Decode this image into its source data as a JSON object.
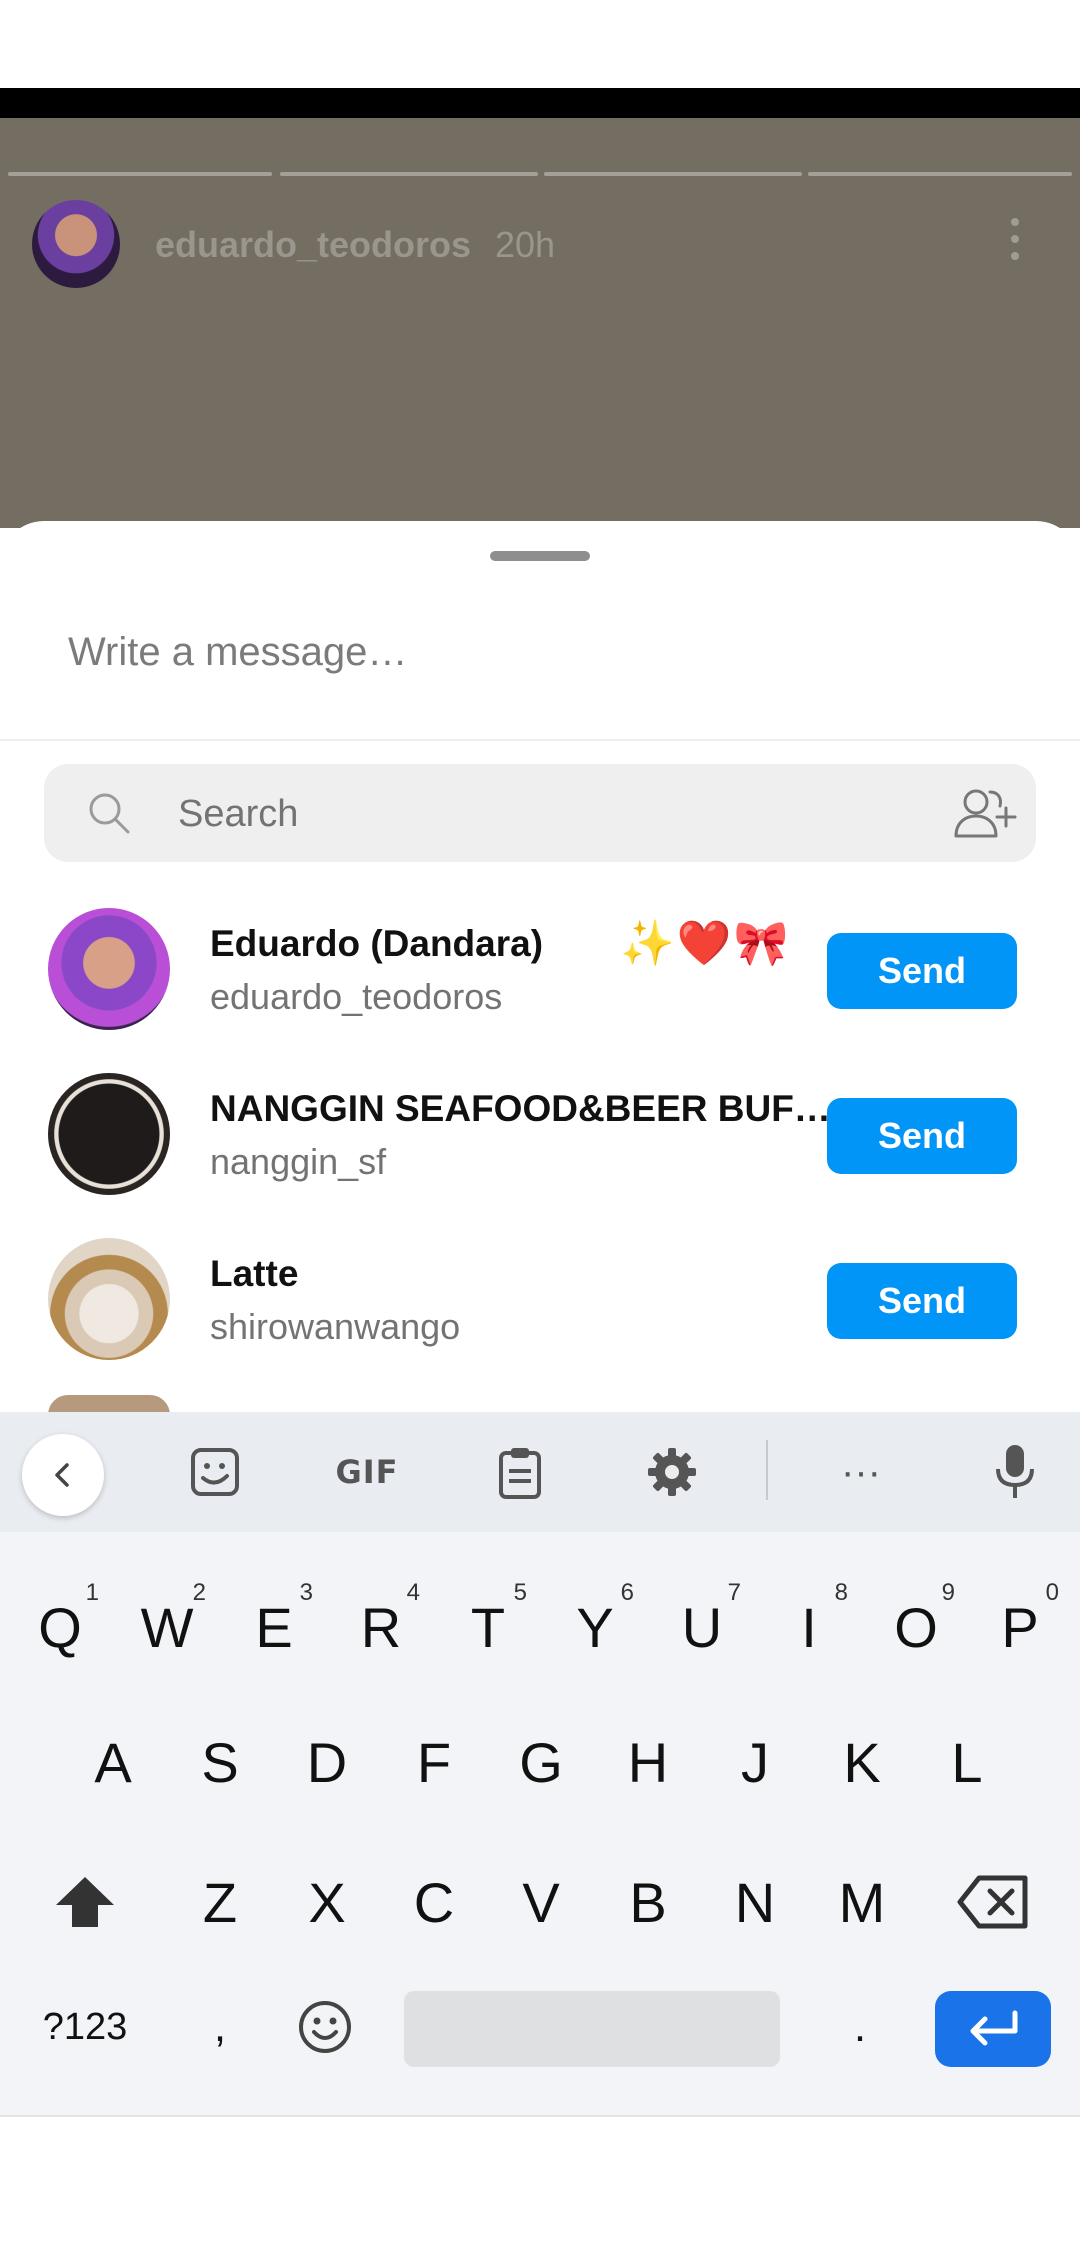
{
  "story": {
    "username": "eduardo_teodoros",
    "time": "20h"
  },
  "share_sheet": {
    "message_placeholder": "Write a message…",
    "search_placeholder": "Search",
    "contacts": [
      {
        "name": "Eduardo  (Dandara)",
        "emoji": "✨❤️🎀",
        "handle": "eduardo_teodoros",
        "send_label": "Send"
      },
      {
        "name": "NANGGIN SEAFOOD&BEER BUF…",
        "handle": "nanggin_sf",
        "send_label": "Send"
      },
      {
        "name": "Latte",
        "handle": "shirowanwango",
        "send_label": "Send"
      }
    ]
  },
  "keyboard": {
    "toolbar": {
      "gif": "GIF",
      "more": "···"
    },
    "row1": [
      {
        "key": "Q",
        "hint": "1"
      },
      {
        "key": "W",
        "hint": "2"
      },
      {
        "key": "E",
        "hint": "3"
      },
      {
        "key": "R",
        "hint": "4"
      },
      {
        "key": "T",
        "hint": "5"
      },
      {
        "key": "Y",
        "hint": "6"
      },
      {
        "key": "U",
        "hint": "7"
      },
      {
        "key": "I",
        "hint": "8"
      },
      {
        "key": "O",
        "hint": "9"
      },
      {
        "key": "P",
        "hint": "0"
      }
    ],
    "row2": [
      "A",
      "S",
      "D",
      "F",
      "G",
      "H",
      "J",
      "K",
      "L"
    ],
    "row3": [
      "Z",
      "X",
      "C",
      "V",
      "B",
      "N",
      "M"
    ],
    "symbols_label": "?123",
    "comma": ",",
    "period": "."
  },
  "colors": {
    "send_button": "#0095f6",
    "enter_key": "#1a73e8"
  }
}
